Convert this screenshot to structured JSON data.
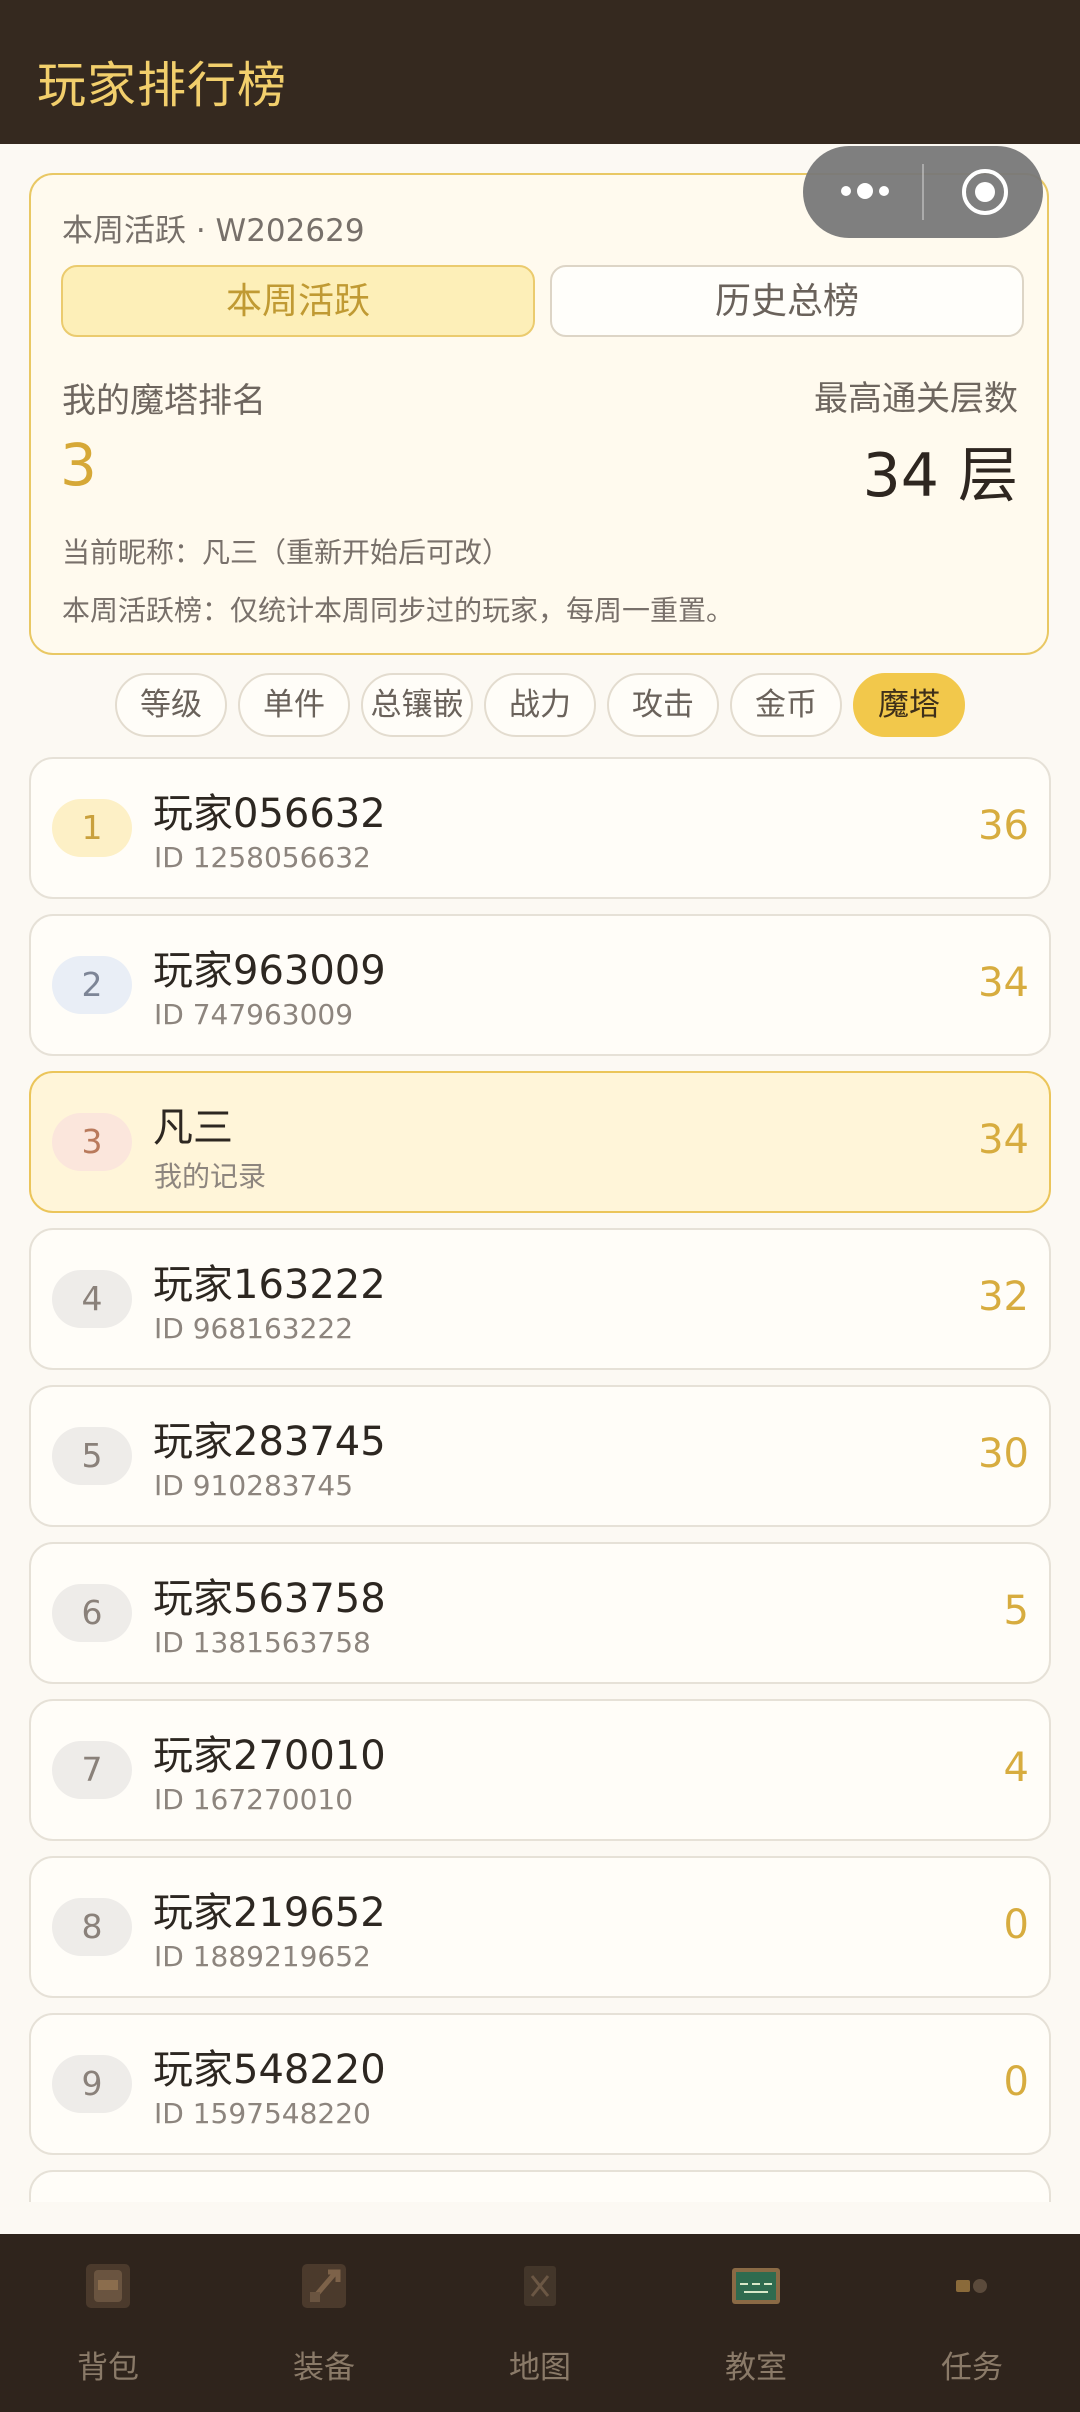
{
  "header": {
    "title": "玩家排行榜"
  },
  "summary": {
    "week_label": "本周活跃 · W202629",
    "tabs": [
      {
        "label": "本周活跃",
        "active": true
      },
      {
        "label": "历史总榜",
        "active": false
      }
    ],
    "my_rank_label": "我的魔塔排名",
    "my_rank_value": "3",
    "best_label": "最高通关层数",
    "best_value": "34 层",
    "nickname_line": "当前昵称：凡三（重新开始后可改）",
    "note_line": "本周活跃榜：仅统计本周同步过的玩家，每周一重置。"
  },
  "categories": [
    {
      "label": "等级",
      "active": false
    },
    {
      "label": "单件",
      "active": false
    },
    {
      "label": "总镶嵌",
      "active": false
    },
    {
      "label": "战力",
      "active": false
    },
    {
      "label": "攻击",
      "active": false
    },
    {
      "label": "金币",
      "active": false
    },
    {
      "label": "魔塔",
      "active": true
    }
  ],
  "rankings": [
    {
      "rank": "1",
      "name": "玩家056632",
      "sub": "ID 1258056632",
      "score": "36"
    },
    {
      "rank": "2",
      "name": "玩家963009",
      "sub": "ID 747963009",
      "score": "34"
    },
    {
      "rank": "3",
      "name": "凡三",
      "sub": "我的记录",
      "score": "34",
      "is_me": true
    },
    {
      "rank": "4",
      "name": "玩家163222",
      "sub": "ID 968163222",
      "score": "32"
    },
    {
      "rank": "5",
      "name": "玩家283745",
      "sub": "ID 910283745",
      "score": "30"
    },
    {
      "rank": "6",
      "name": "玩家563758",
      "sub": "ID 1381563758",
      "score": "5"
    },
    {
      "rank": "7",
      "name": "玩家270010",
      "sub": "ID 167270010",
      "score": "4"
    },
    {
      "rank": "8",
      "name": "玩家219652",
      "sub": "ID 1889219652",
      "score": "0"
    },
    {
      "rank": "9",
      "name": "玩家548220",
      "sub": "ID 1597548220",
      "score": "0"
    }
  ],
  "tabbar": [
    {
      "label": "背包",
      "icon": "backpack-icon"
    },
    {
      "label": "装备",
      "icon": "equipment-icon"
    },
    {
      "label": "地图",
      "icon": "map-icon"
    },
    {
      "label": "教室",
      "icon": "classroom-blackboard-icon"
    },
    {
      "label": "任务",
      "icon": "task-icon"
    }
  ],
  "colors": {
    "accent": "#f2c84b",
    "header_bg": "#35291f",
    "score": "#d7ac3f"
  }
}
